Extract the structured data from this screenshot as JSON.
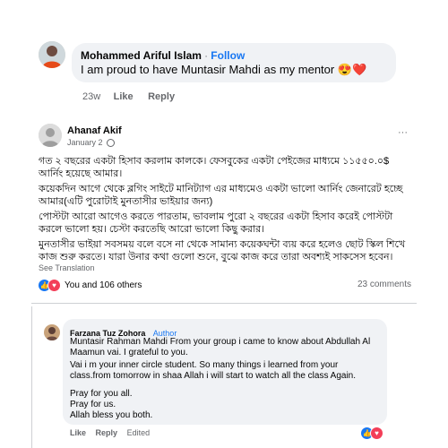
{
  "top_comment": {
    "author": "Mohammed Ariful Islam",
    "separator": "·",
    "follow_label": "Follow",
    "text": "I am proud to have Muntasir Mahdi as my mentor",
    "emoji": "😍❤️",
    "time": "23w",
    "like_label": "Like",
    "reply_label": "Reply"
  },
  "post": {
    "author": "Ahanaf Akif",
    "date": "January 2",
    "privacy_icon": "globe-icon",
    "more_label": "···",
    "paragraphs": [
      "গত ২ বছরের একটা হিসাব করলাম কালকে। ফেসবুকের একটা পেইজের মাধ্যমে ১১৫৫০.০$ আর্নিং হয়েছে আমার।",
      "কয়েকদিন আগে থেকে ব্লগিং সাইটে মানিট্যাগ এর মাধ্যমেও একটা ভালো আর্নিং জেনারেট হচ্ছে আমার(এটি পুরোটাই মুনতাসীর ভাইয়ার জন্য)",
      "পোস্টটা আরো আগেও করতে পারতাম, ভাবলাম পুরো ২ বছরের একটা হিসাব করেই পোস্টটা করলে ভালো হয়। চেস্টা করতেছি আরো ভালো কিছু করার।",
      "মুনতাসীর ভাইয়া সবসময় বলে বসে না থেকে সামান্য কয়েকঘন্টা ব্যয় করে হলেও ছোট স্কিল শিখে কাজ শুরু করতে। যারা উনার কথা গুলো শুনে, বুঝে কাজ করে তারা অবশ্যই সাকসেস হবেন।"
    ],
    "see_translation": "See Translation",
    "reactions_text": "You and 106 others",
    "comments_count": "23 comments"
  },
  "reply": {
    "author": "Farzana Tuz Zohora",
    "badge": "Author",
    "lines": [
      "Muntasir Rahman Mahdi From your group i came to know about Abdullah Al Maamun vai. I grateful to you.",
      "Vai i m your inner circle student. So many things i learned from your class.from tomorrow in shaa Allah i will start to watch all the class Again.",
      "Pray for you all.",
      "Pray for us.",
      "Allah bless you both."
    ],
    "actions": [
      "Like",
      "Reply",
      "Edited"
    ]
  },
  "colors": {
    "brand": "#1877f2",
    "bubble": "#f0f2f5",
    "muted": "#65676b",
    "like_blue": "#1877f2",
    "love_red": "#f33e58"
  }
}
